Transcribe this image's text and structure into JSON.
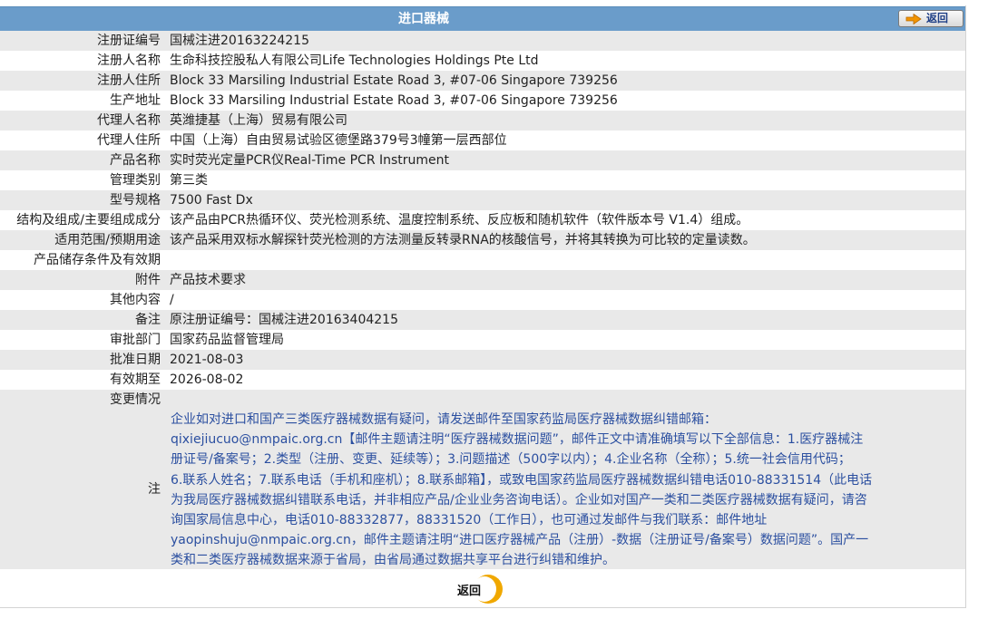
{
  "header": {
    "title": "进口器械",
    "back_label": "返回"
  },
  "rows": [
    {
      "label": "注册证编号",
      "value": "国械注进20163224215"
    },
    {
      "label": "注册人名称",
      "value": "生命科技控股私人有限公司Life Technologies Holdings Pte Ltd"
    },
    {
      "label": "注册人住所",
      "value": "Block 33 Marsiling Industrial Estate Road 3, #07-06 Singapore 739256"
    },
    {
      "label": "生产地址",
      "value": "Block 33 Marsiling Industrial Estate Road 3, #07-06 Singapore 739256"
    },
    {
      "label": "代理人名称",
      "value": "英潍捷基（上海）贸易有限公司"
    },
    {
      "label": "代理人住所",
      "value": "中国（上海）自由贸易试验区德堡路379号3幢第一层西部位"
    },
    {
      "label": "产品名称",
      "value": "实时荧光定量PCR仪Real-Time PCR Instrument"
    },
    {
      "label": "管理类别",
      "value": "第三类"
    },
    {
      "label": "型号规格",
      "value": "7500 Fast Dx"
    },
    {
      "label": "结构及组成/主要组成成分",
      "value": "该产品由PCR热循环仪、荧光检测系统、温度控制系统、反应板和随机软件（软件版本号 V1.4）组成。"
    },
    {
      "label": "适用范围/预期用途",
      "value": "该产品采用双标水解探针荧光检测的方法测量反转录RNA的核酸信号，并将其转换为可比较的定量读数。"
    },
    {
      "label": "产品储存条件及有效期",
      "value": ""
    },
    {
      "label": "附件",
      "value": "产品技术要求"
    },
    {
      "label": "其他内容",
      "value": "/"
    },
    {
      "label": "备注",
      "value": "原注册证编号：国械注进20163404215"
    },
    {
      "label": "审批部门",
      "value": "国家药品监督管理局"
    },
    {
      "label": "批准日期",
      "value": "2021-08-03"
    },
    {
      "label": "有效期至",
      "value": "2026-08-02"
    },
    {
      "label": "变更情况",
      "value": ""
    }
  ],
  "note": {
    "label": "注",
    "lines": [
      "企业如对进口和国产三类医疗器械数据有疑问，请发送邮件至国家药监局医疗器械数据纠错邮箱：",
      "qixiejiucuo@nmpaic.org.cn【邮件主题请注明“医疗器械数据问题”，邮件正文中请准确填写以下全部信息：1.医疗器械注",
      "册证号/备案号；2.类型（注册、变更、延续等）；3.问题描述（500字以内）；4.企业名称（全称）；5.统一社会信用代码；",
      "6.联系人姓名；7.联系电话（手机和座机）；8.联系邮箱】，或致电国家药监局医疗器械数据纠错电话010-88331514（此电话",
      "为我局医疗器械数据纠错联系电话，并非相应产品/企业业务咨询电话）。企业如对国产一类和二类医疗器械数据有疑问，请咨",
      "询国家局信息中心，电话010-88332877，88331520（工作日），也可通过发邮件与我们联系：邮件地址",
      "yaopinshuju@nmpaic.org.cn，邮件主题请注明“进口医疗器械产品（注册）-数据（注册证号/备案号）数据问题”。国产一",
      "类和二类医疗器械数据来源于省局，由省局通过数据共享平台进行纠错和维护。"
    ]
  },
  "footer": {
    "back_label": "返回"
  },
  "colors": {
    "title_bar": "#6a9cca",
    "row_shade": "#e9e9e9",
    "note_text": "#2b4fa0",
    "bottom_button_ring": "#f0a800"
  }
}
